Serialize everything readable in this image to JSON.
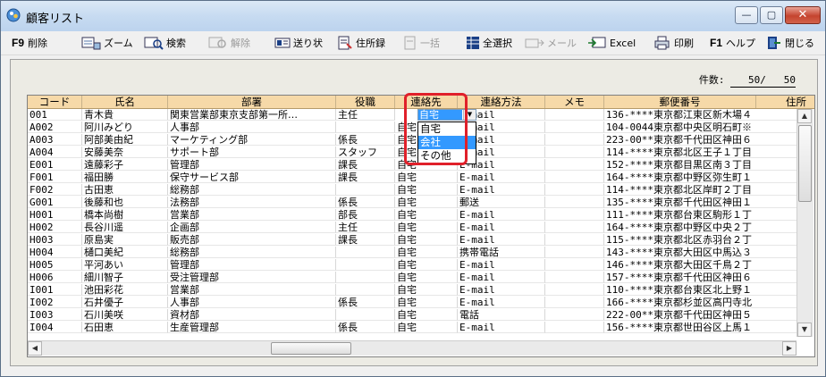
{
  "window": {
    "title": "顧客リスト",
    "min_icon": "minimize-icon",
    "max_icon": "maximize-icon",
    "close_icon": "close-icon"
  },
  "toolbar": {
    "delete": {
      "key": "F9",
      "label": "削除"
    },
    "zoom": "ズーム",
    "search": "検索",
    "release": "解除",
    "invoice": "送り状",
    "address_book": "住所録",
    "bulk": "一括",
    "select_all": "全選択",
    "mail": "メール",
    "excel": "Excel",
    "print": "印刷",
    "help": {
      "key": "F1",
      "label": "ヘルプ"
    },
    "close": "閉じる"
  },
  "count": {
    "label": "件数:",
    "current": "50",
    "sep": "/",
    "total": "50"
  },
  "grid": {
    "columns": [
      "コード",
      "氏名",
      "部署",
      "役職",
      "連絡先",
      "連絡方法",
      "メモ",
      "郵便番号",
      "住所"
    ],
    "rows": [
      [
        "001",
        "青木貴",
        "関東営業部東京支部第一所…",
        "主任",
        "自宅",
        "E-mail",
        "",
        "136-****東京都江東区新木場４"
      ],
      [
        "A002",
        "阿川みどり",
        "人事部",
        "",
        "自宅",
        "E-mail",
        "",
        "104-0044東京都中央区明石町※"
      ],
      [
        "A003",
        "阿部美由紀",
        "マーケティング部",
        "係長",
        "自宅",
        "E-mail",
        "",
        "223-00**東京都千代田区神田６"
      ],
      [
        "A004",
        "安藤美奈",
        "サポート部",
        "スタッフ",
        "自宅",
        "E-mail",
        "",
        "114-****東京都北区王子１丁目"
      ],
      [
        "E001",
        "遠藤彩子",
        "管理部",
        "課長",
        "自宅",
        "E-mail",
        "",
        "152-****東京都目黒区南３丁目"
      ],
      [
        "F001",
        "福田勝",
        "保守サービス部",
        "課長",
        "自宅",
        "E-mail",
        "",
        "164-****東京都中野区弥生町１"
      ],
      [
        "F002",
        "古田恵",
        "総務部",
        "",
        "自宅",
        "E-mail",
        "",
        "114-****東京都北区岸町２丁目"
      ],
      [
        "G001",
        "後藤和也",
        "法務部",
        "係長",
        "自宅",
        "郵送",
        "",
        "135-****東京都千代田区神田１"
      ],
      [
        "H001",
        "橋本尚樹",
        "営業部",
        "部長",
        "自宅",
        "E-mail",
        "",
        "111-****東京都台東区駒形１丁"
      ],
      [
        "H002",
        "長谷川遥",
        "企画部",
        "主任",
        "自宅",
        "E-mail",
        "",
        "164-****東京都中野区中央２丁"
      ],
      [
        "H003",
        "原島実",
        "販売部",
        "課長",
        "自宅",
        "E-mail",
        "",
        "115-****東京都北区赤羽台２丁"
      ],
      [
        "H004",
        "樋口美紀",
        "総務部",
        "",
        "自宅",
        "携帯電話",
        "",
        "143-****東京都大田区中馬込３"
      ],
      [
        "H005",
        "平河あい",
        "管理部",
        "",
        "自宅",
        "E-mail",
        "",
        "146-****東京都大田区千鳥２丁"
      ],
      [
        "H006",
        "細川智子",
        "受注管理部",
        "",
        "自宅",
        "E-mail",
        "",
        "157-****東京都千代田区神田６"
      ],
      [
        "I001",
        "池田彩花",
        "営業部",
        "",
        "自宅",
        "E-mail",
        "",
        "110-****東京都台東区北上野１"
      ],
      [
        "I002",
        "石井優子",
        "人事部",
        "係長",
        "自宅",
        "E-mail",
        "",
        "166-****東京都杉並区高円寺北"
      ],
      [
        "I003",
        "石川美咲",
        "資材部",
        "",
        "自宅",
        "電話",
        "",
        "222-00**東京都千代田区神田５"
      ],
      [
        "I004",
        "石田恵",
        "生産管理部",
        "係長",
        "自宅",
        "E-mail",
        "",
        "156-****東京都世田谷区上馬１"
      ]
    ],
    "contact_dropdown": {
      "selected": "自宅",
      "options": [
        "自宅",
        "会社",
        "その他"
      ],
      "highlighted": "会社"
    }
  }
}
